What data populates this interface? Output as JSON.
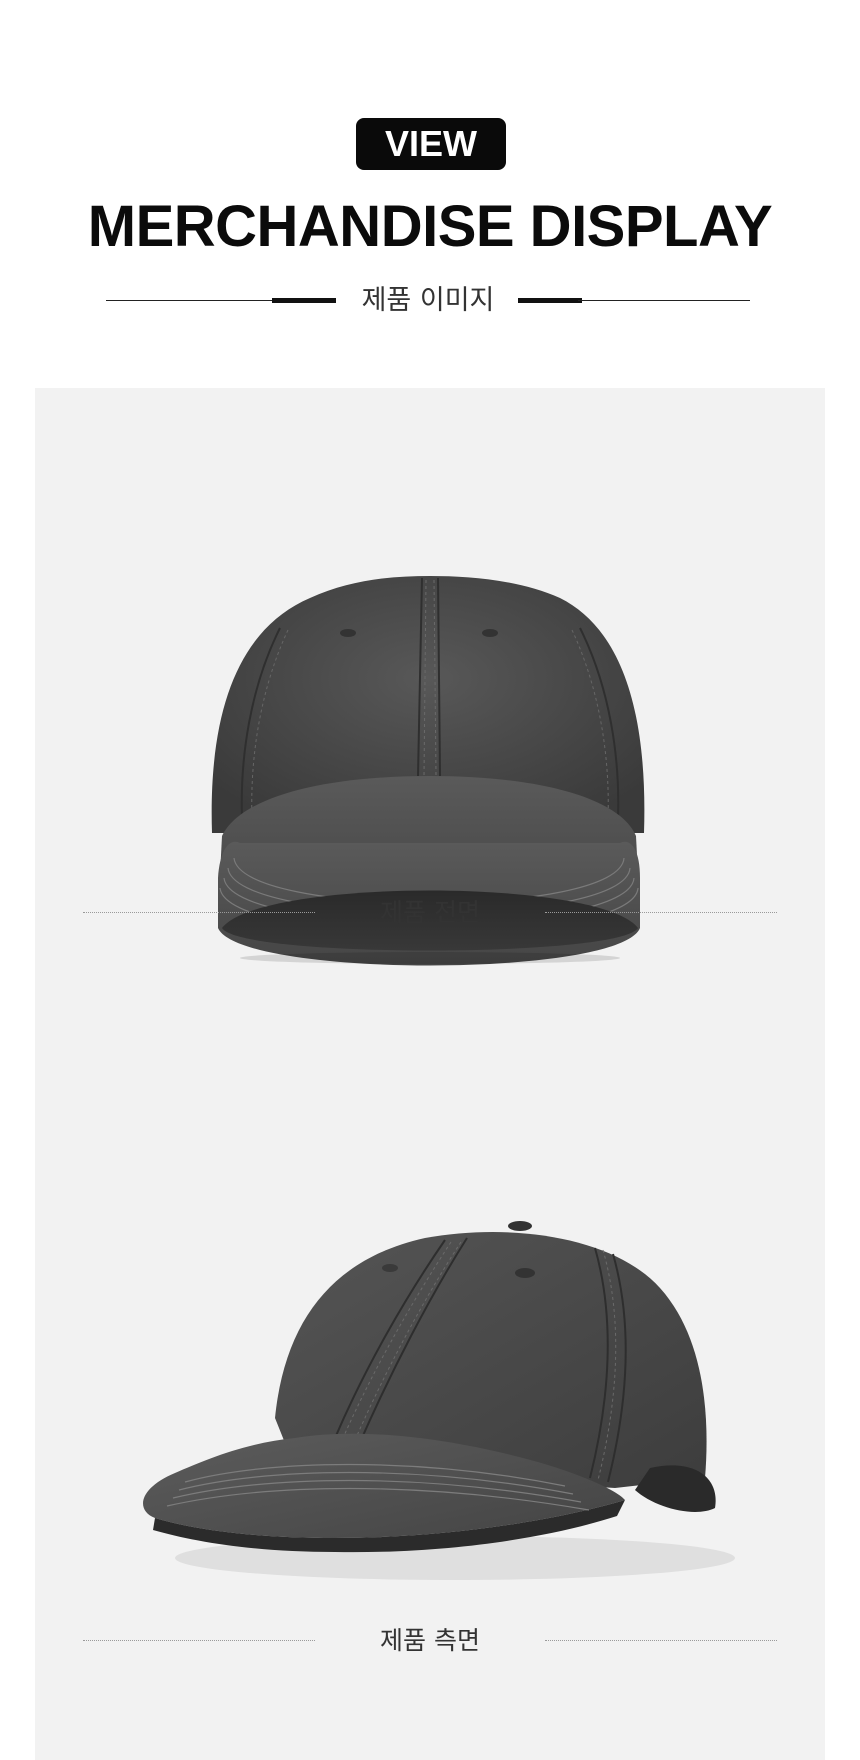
{
  "header": {
    "badge": "VIEW",
    "title": "MERCHANDISE DISPLAY",
    "subtitle": "제품 이미지"
  },
  "products": [
    {
      "caption": "제품 전면",
      "image_icon": "baseball-cap-front-image"
    },
    {
      "caption": "제품 측면",
      "image_icon": "baseball-cap-side-image"
    }
  ],
  "colors": {
    "background": "#ffffff",
    "panel": "#f2f2f2",
    "cap": "#4a4a4a",
    "badge": "#0a0a0a"
  }
}
